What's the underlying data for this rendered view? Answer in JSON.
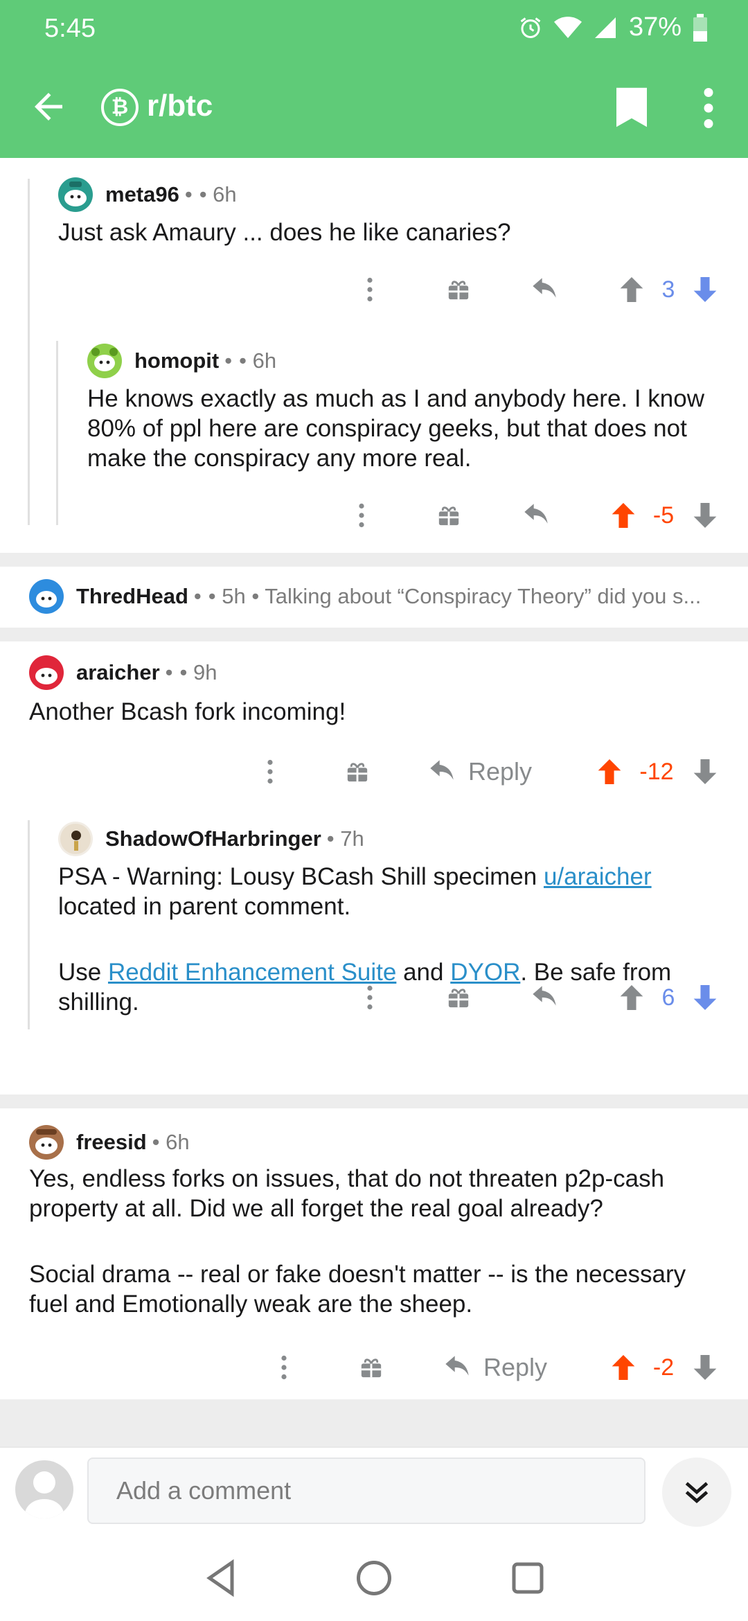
{
  "status_bar": {
    "time": "5:45",
    "battery": "37%"
  },
  "header": {
    "subreddit": "r/btc",
    "sub_icon_glyph": "₿"
  },
  "comments": {
    "meta96": {
      "username": "meta96",
      "dot": "•",
      "meta": "• 6h",
      "body": "Just ask Amaury ... does he like canaries?",
      "score": "3"
    },
    "homopit": {
      "username": "homopit",
      "dot": "•",
      "meta": "• 6h",
      "body": "He knows exactly as much as I and anybody here. I know 80% of ppl here are conspiracy geeks, but that does not make the conspiracy any more real.",
      "score": "-5"
    },
    "thredhead": {
      "username": "ThredHead",
      "dot": "•",
      "meta": "• 5h • Talking about “Conspiracy Theory” did you s..."
    },
    "araicher": {
      "username": "araicher",
      "dot": "•",
      "meta": "• 9h",
      "body": "Another Bcash fork incoming!",
      "reply_label": "Reply",
      "score": "-12"
    },
    "shadow": {
      "username": "ShadowOfHarbringer",
      "meta": "• 7h",
      "line1_prefix": "PSA - Warning: Lousy BCash Shill specimen ",
      "line1_link": "u/araicher",
      "line1_suffix": "located in parent comment.",
      "line2_prefix": "Use ",
      "line2_link1": "Reddit Enhancement Suite",
      "line2_mid": " and ",
      "line2_link2": "DYOR",
      "line2_suffix": ". Be safe from shilling.",
      "score": "6"
    },
    "freesid": {
      "username": "freesid",
      "meta": "• 6h",
      "para1": "Yes, endless forks on issues, that do not threaten p2p-cash property at all. Did we all forget the real goal already?",
      "para2": "Social drama -- real or fake doesn't matter -- is the necessary fuel and Emotionally weak are the sheep.",
      "reply_label": "Reply",
      "score": "-2"
    }
  },
  "comment_bar": {
    "placeholder": "Add a comment"
  },
  "colors": {
    "header": "#5fcb78",
    "upvote": "#ff4500",
    "downvote_blue": "#6a8dea",
    "link": "#2a8fc9"
  }
}
